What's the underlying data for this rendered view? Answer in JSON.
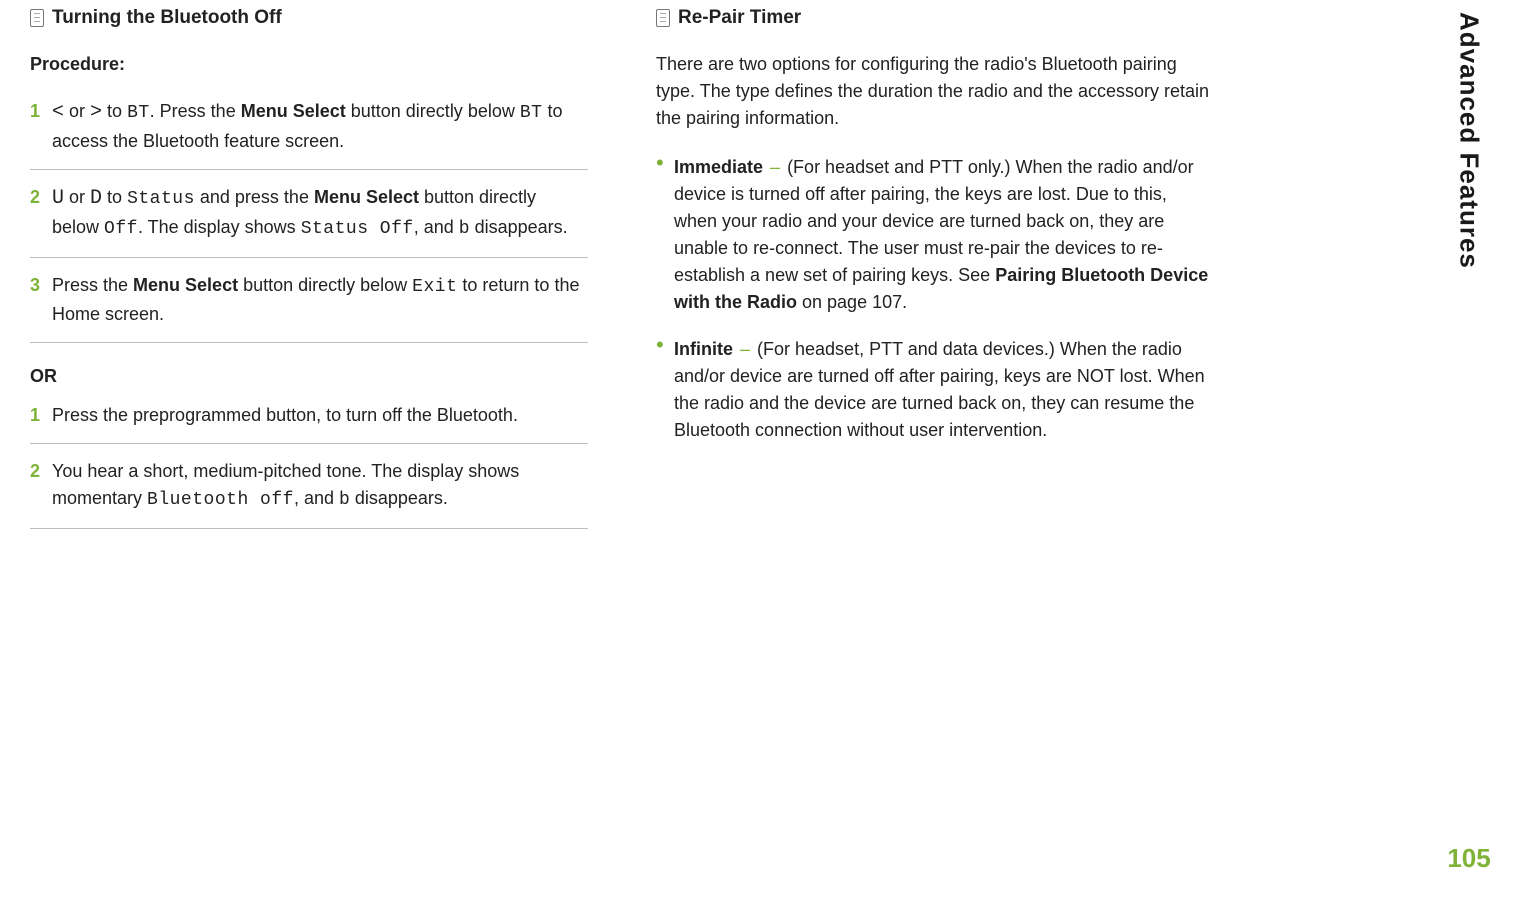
{
  "sidebar": {
    "title": "Advanced Features",
    "page": "105"
  },
  "left": {
    "heading": "Turning the Bluetooth Off",
    "procedure_label": "Procedure:",
    "steps_a": [
      {
        "pre": "",
        "nav_l": "<",
        "mid1": " or ",
        "nav_r": ">",
        "mid2": " to ",
        "code1": "BT",
        "txt1": ". Press the ",
        "b1": "Menu Select",
        "txt2": " button directly below ",
        "code2": "BT",
        "txt3": " to access the Bluetooth feature screen."
      },
      {
        "k1": "U",
        "mid1": " or ",
        "k2": "D",
        "mid2": " to ",
        "code1": "Status",
        "txt1": " and press the ",
        "b1": "Menu Select",
        "txt2": " button directly below ",
        "code2": "Off",
        "txt3": ". The display shows ",
        "code3": "Status Off",
        "txt4": ", and ",
        "sym": "b",
        "txt5": " disappears."
      },
      {
        "txt1": "Press the ",
        "b1": "Menu Select",
        "txt2": " button directly below ",
        "code1": "Exit",
        "txt3": " to return to the Home screen."
      }
    ],
    "or": "OR",
    "steps_b": [
      {
        "txt": "Press the preprogrammed button, to turn off the Bluetooth."
      },
      {
        "txt1": "You hear a short, medium-pitched tone. The display shows momentary ",
        "code1": "Bluetooth off",
        "txt2": ", and ",
        "sym": "b",
        "txt3": " disappears."
      }
    ]
  },
  "right": {
    "heading": "Re-Pair Timer",
    "intro": "There are two options for configuring the radio's Bluetooth pairing type. The type defines the duration the radio and the accessory retain the pairing information.",
    "bullets": [
      {
        "title": "Immediate",
        "body1": "(For headset and PTT only.) When the radio and/or device is turned off after pairing, the keys are lost. Due to this, when your radio and your device are turned back on, they are unable to re-connect. The user must re-pair the devices to re-establish a new set of pairing keys. See ",
        "ref": "Pairing Bluetooth Device with the Radio",
        "body2": " on ",
        "page_ref": "page 107",
        "body3": "."
      },
      {
        "title": "Infinite",
        "body1": "(For headset, PTT and data devices.) When the radio and/or device are turned off after pairing, keys are NOT lost. When the radio and the device are turned back on, they can resume the Bluetooth connection without user intervention."
      }
    ]
  }
}
